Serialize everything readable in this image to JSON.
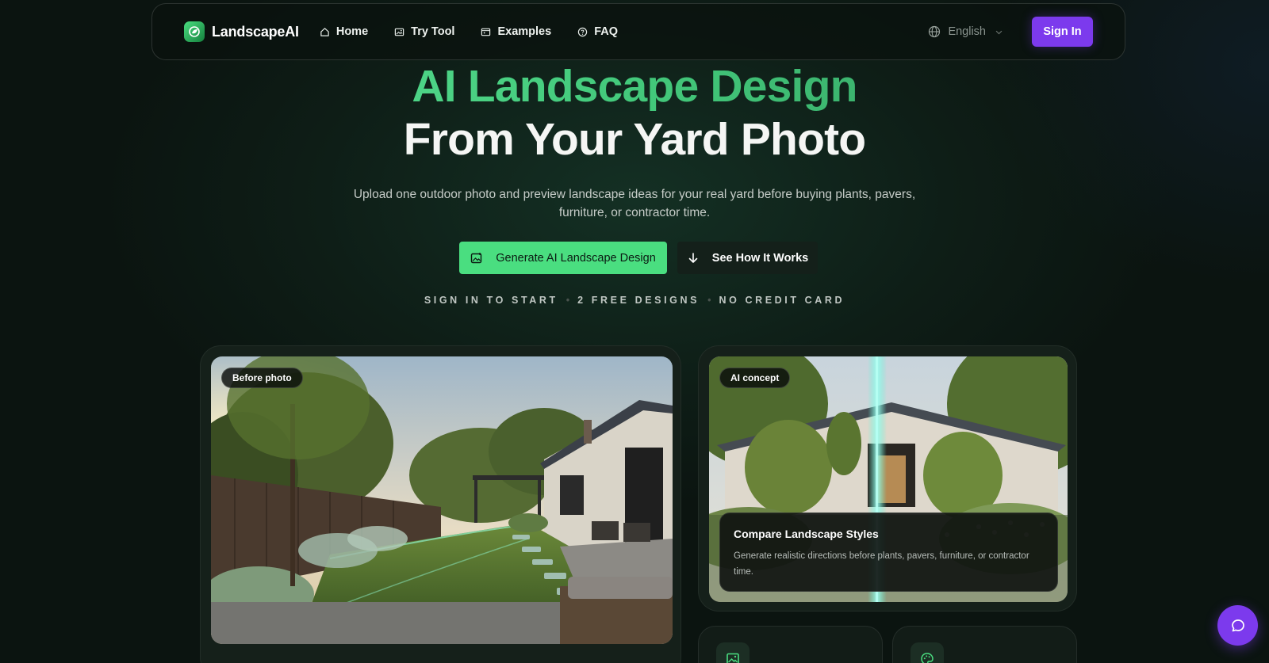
{
  "nav": {
    "brand": "LandscapeAI",
    "links": [
      {
        "label": "Home",
        "icon": "home-icon"
      },
      {
        "label": "Try Tool",
        "icon": "image-icon"
      },
      {
        "label": "Examples",
        "icon": "gallery-icon"
      },
      {
        "label": "FAQ",
        "icon": "help-circle-icon"
      }
    ],
    "language": "English",
    "signin_label": "Sign In"
  },
  "hero": {
    "title_line1": "AI Landscape Design",
    "title_line2": "From Your Yard Photo",
    "subtitle": "Upload one outdoor photo and preview landscape ideas for your real yard before buying plants, pavers, furniture, or contractor time.",
    "primary_cta": "Generate AI Landscape Design",
    "secondary_cta": "See How It Works",
    "tags": [
      "SIGN IN TO START",
      "2 FREE DESIGNS",
      "NO CREDIT CARD"
    ]
  },
  "cards": {
    "before_badge": "Before photo",
    "ai_badge": "AI concept",
    "ai_overlay_title": "Compare Landscape Styles",
    "ai_overlay_desc": "Generate realistic directions before plants, pavers, furniture, or contractor time."
  },
  "colors": {
    "accent_green": "#4ade80",
    "accent_purple": "#7c3aed",
    "background": "#0b1410"
  }
}
